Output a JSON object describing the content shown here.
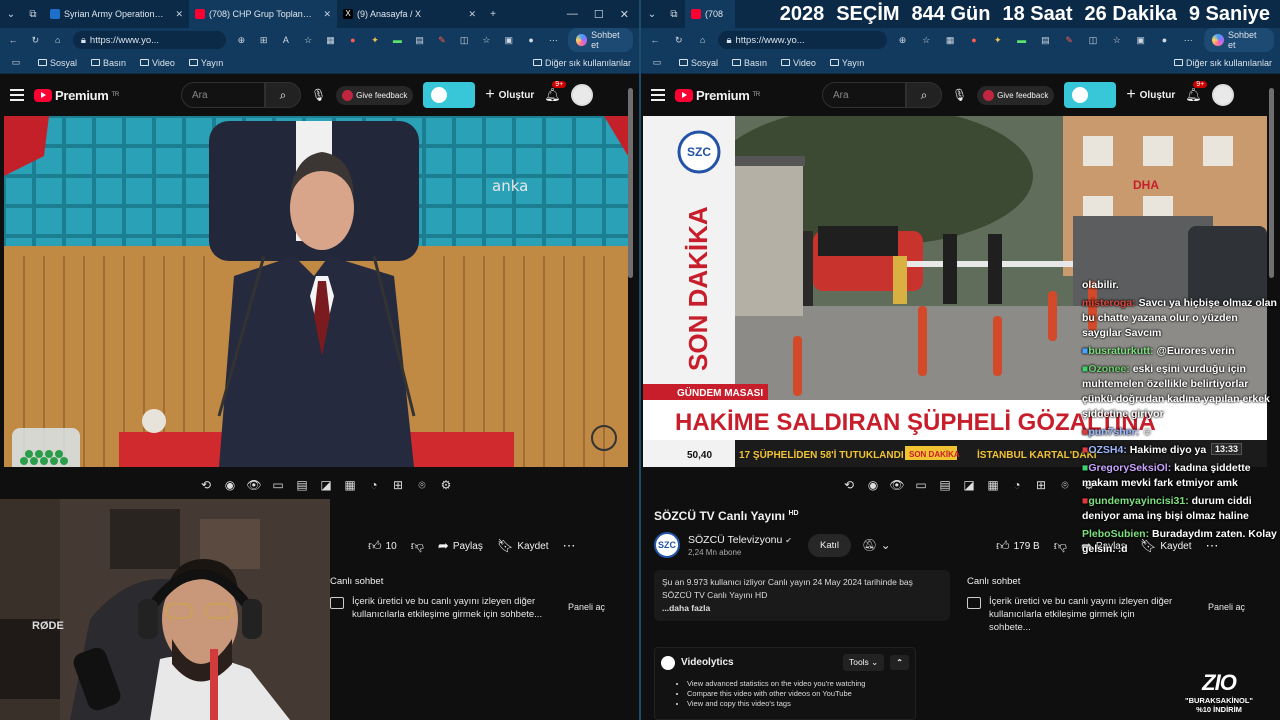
{
  "left": {
    "tabs": [
      {
        "title": "Syrian Army Operations Comm",
        "color": "#1d6fc9"
      },
      {
        "title": "(708) CHP Grup Toplantısı / TBM",
        "color": "#ff0033",
        "active": true
      },
      {
        "title": "(9) Anasayfa / X",
        "color": "#000000"
      }
    ],
    "url": "https://www.yo...",
    "sohbet_label": "Sohbet et",
    "bookmarks": [
      "Sosyal",
      "Basın",
      "Video",
      "Yayın"
    ],
    "bookmarks_other": "Diğer sık kullanılanlar",
    "yt": {
      "brand": "Premium",
      "region": "TR",
      "search_placeholder": "Ara",
      "feedback": "Give feedback",
      "create": "Oluştur",
      "notif_count": "9+"
    },
    "video_watermark": "anka",
    "actions": {
      "likes": "10",
      "share": "Paylaş",
      "save": "Kaydet"
    },
    "chat_title": "Canlı sohbet",
    "chat_info": "İçerik üretici ve bu canlı yayını izleyen diğer kullanıcılarla etkileşime girmek için sohbete...",
    "panel_open": "Paneli aç",
    "mic_brand": "RØDE"
  },
  "right": {
    "tabs": [
      {
        "title": "(708",
        "color": "#ff0033"
      }
    ],
    "url": "https://www.yo...",
    "sohbet_label": "Sohbet et",
    "bookmarks": [
      "Sosyal",
      "Basın",
      "Video",
      "Yayın"
    ],
    "bookmarks_other": "Diğer sık kullanılanlar",
    "yt": {
      "brand": "Premium",
      "region": "TR",
      "search_placeholder": "Ara",
      "feedback": "Give feedback",
      "create": "Oluştur",
      "notif_count": "9+"
    },
    "banner": {
      "year": "2028",
      "label": "SEÇİM",
      "days": "844 Gün",
      "hours": "18 Saat",
      "minutes": "26 Dakika",
      "seconds": "9 Saniye"
    },
    "news": {
      "channel_logo": "SZC",
      "vertical": "SON DAKİKA",
      "desk": "GÜNDEM MASASI",
      "headline": "HAKİME SALDIRAN ŞÜPHELİ GÖZALTINA",
      "rate": "50,40",
      "ticker1": "17 ŞÜPHELİDEN 58'İ TUTUKLANDI",
      "ticker_tag": "SON DAKİKA",
      "ticker2": "İSTANBUL KARTAL'DAKİ",
      "dha": "DHA",
      "clock": "13:33"
    },
    "video_title": "SÖZCÜ TV Canlı Yayını",
    "video_title_badge": "HD",
    "channel_name": "SÖZCÜ Televizyonu",
    "channel_subs": "2,24 Mn abone",
    "join": "Katıl",
    "actions": {
      "likes": "179 B",
      "share": "Paylaş",
      "save": "Kaydet"
    },
    "description": {
      "line1": "Şu an 9.973 kullanıcı izliyor  Canlı yayın 24 May 2024 tarihinde baş",
      "line2": "SÖZCÜ TV Canlı Yayını HD",
      "more": "...daha fazla"
    },
    "chat_title": "Canlı sohbet",
    "chat_info": "İçerik üretici ve bu canlı yayını izleyen diğer kullanıcılarla etkileşime girmek için sohbete...",
    "panel_open": "Paneli aç",
    "videolytics": {
      "title": "Videolytics",
      "tools": "Tools",
      "items": [
        "View advanced statistics on the video you're watching",
        "Compare this video with other videos on YouTube",
        "View and copy this video's tags"
      ]
    }
  },
  "overlay_chat": [
    {
      "user": "",
      "text": "olabilir.",
      "color": "#ffffff"
    },
    {
      "user": "misteroga:",
      "text": "Savcı ya hiçbişe olmaz olan bu chatte yazana olur o yüzden saygılar Savcım",
      "color": "#d9473d"
    },
    {
      "user": "busraturkutt:",
      "text": "@Eurores verin",
      "color": "#7ee07e"
    },
    {
      "user": "Ozonee:",
      "text": "eski eşini vurduğu için muhtemelen özellikle belirtiyorlar çünkü doğrudan kadına yapılan erkek şiddetine giriyor",
      "color": "#6fd06f"
    },
    {
      "user": "pun7sher:",
      "text": "",
      "color": "#9fb8ff"
    },
    {
      "user": "OZSH4:",
      "text": "Hakime diyo ya",
      "color": "#9fb8ff"
    },
    {
      "user": "GregorySeksiOl:",
      "text": "kadına şiddette makam mevki fark etmiyor amk",
      "color": "#c9a5ff"
    },
    {
      "user": "gundemyayincisi31:",
      "text": "durum ciddi deniyor ama inş bişi olmaz haline",
      "color": "#7ee07e"
    },
    {
      "user": "PleboSubien:",
      "text": "Buradaydım zaten. Kolay gelsin. .d",
      "color": "#7ee07e"
    }
  ],
  "promo": {
    "logo": "ZIO",
    "code": "\"BURAKSAKİNOL\"",
    "discount": "%10 İNDİRİM"
  },
  "colors": {
    "browser_bg": "#123a5e",
    "tabstrip": "#0b2a47",
    "yt_red": "#ff0033",
    "accent_toggle": "#37c7d8",
    "headline_red": "#c81e2b"
  }
}
